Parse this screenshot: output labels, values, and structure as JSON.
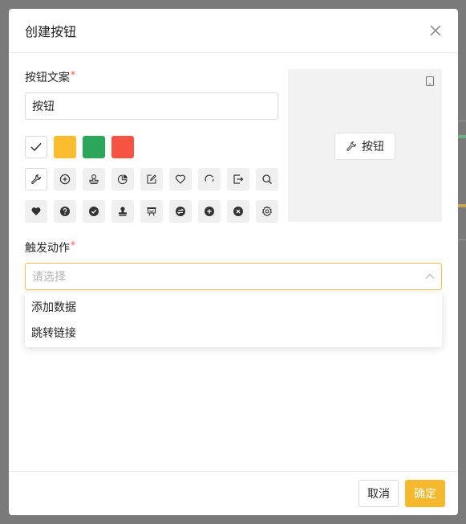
{
  "modal": {
    "title": "创建按钮",
    "close_icon": "close-icon"
  },
  "button_text_field": {
    "label": "按钮文案",
    "required_mark": "*",
    "value": "按钮"
  },
  "colors": [
    {
      "name": "white",
      "hex": "#ffffff",
      "selected": true
    },
    {
      "name": "yellow",
      "hex": "#fbbd2e"
    },
    {
      "name": "green",
      "hex": "#2ca65a"
    },
    {
      "name": "red",
      "hex": "#f55443"
    }
  ],
  "icons": [
    "wrench-icon",
    "plus-circle-icon",
    "stamp-icon",
    "pie-chart-icon",
    "edit-square-icon",
    "heart-outline-icon",
    "loading-arc-icon",
    "export-icon",
    "search-icon",
    "heart-filled-icon",
    "question-circle-icon",
    "check-circle-icon",
    "stamp-filled-icon",
    "flag-board-icon",
    "swap-circle-icon",
    "plus-circle-filled-icon",
    "close-circle-icon",
    "setting-icon"
  ],
  "preview": {
    "button_label": "按钮",
    "button_icon": "wrench-icon",
    "device_icon": "tablet-icon"
  },
  "trigger_field": {
    "label": "触发动作",
    "required_mark": "*",
    "placeholder": "请选择",
    "options": [
      "添加数据",
      "跳转链接"
    ]
  },
  "footer": {
    "cancel_label": "取消",
    "ok_label": "确定"
  },
  "theme": {
    "accent": "#f5b82e",
    "required": "#ff4d4f"
  }
}
